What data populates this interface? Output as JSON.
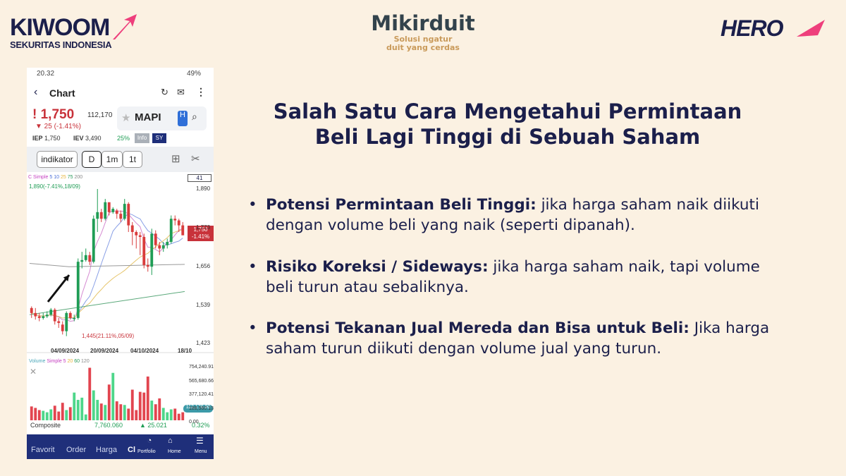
{
  "logos": {
    "kiwoom": "KIWOOM",
    "kiwoom_sub": "SEKURITAS INDONESIA",
    "mikirduit": "Mikirduit",
    "mikirduit_tag1": "Solusi ngatur",
    "mikirduit_tag2": "duit yang cerdas",
    "hero": "HERO"
  },
  "colors": {
    "navy": "#1b1f4b",
    "up": "#1f9d55",
    "down": "#d93c3c",
    "bg": "#fbf1e2"
  },
  "slide": {
    "title_line1": "Salah Satu Cara Mengetahui Permintaan",
    "title_line2": "Beli Lagi Tinggi di Sebuah Saham",
    "bullets": [
      {
        "bold": "Potensi Permintaan Beli Tinggi:",
        "text": " jika harga saham naik diikuti dengan volume beli yang naik (seperti dipanah)."
      },
      {
        "bold": "Risiko Koreksi / Sideways:",
        "text": " jika harga saham naik, tapi volume beli turun atau sebaliknya."
      },
      {
        "bold": "Potensi Tekanan Jual Mereda dan Bisa untuk Beli:",
        "text": " Jika harga saham turun diikuti dengan volume jual yang turun."
      }
    ]
  },
  "phone": {
    "status": {
      "time": "20.32",
      "battery": "49%"
    },
    "header": {
      "title": "Chart"
    },
    "quote": {
      "price": "1,750",
      "change": "▼ 25 (-1.41%)",
      "volume": "112,170",
      "ticker": "MAPI",
      "board": "H",
      "iep_label": "IEP",
      "iep": "1,750",
      "iev_label": "IEV",
      "iev": "3,490",
      "pct": "25%",
      "info": "Info",
      "sy": "SY"
    },
    "toolbar": {
      "indikator": "indikator",
      "d": "D",
      "m1": "1m",
      "t1": "1t"
    },
    "indicator_legend": {
      "c": "C Simple",
      "p5": "5",
      "p10": "10",
      "p25": "25",
      "p75": "75",
      "p200": "200",
      "count": "41"
    },
    "price_axis": [
      "1,890",
      "1,773",
      "1,656",
      "1,539",
      "1,423"
    ],
    "annotations": {
      "high": "1,890(-7.41%,18/09)",
      "low": "1,445(21.11%,05/09)",
      "last_price": "1,750",
      "last_change": "-1.41%"
    },
    "date_axis": [
      "04/09/2024",
      "20/09/2024",
      "04/10/2024",
      "18/10"
    ],
    "volume_legend": {
      "v": "Volume",
      "s": "Simple",
      "p5": "5",
      "p20": "20",
      "p60": "60",
      "p120": "120"
    },
    "volume_axis": [
      "754,240.91",
      "565,680.66",
      "377,120.41",
      "188,560.13",
      "0.00"
    ],
    "volume_last": "112,170.00",
    "composite": {
      "label": "Composite",
      "value": "7,760.060",
      "change": "▲ 25.021",
      "pct": "0.32%"
    },
    "nav": [
      {
        "label": "Favorit"
      },
      {
        "label": "Order"
      },
      {
        "label": "Harga"
      },
      {
        "label": "Cl"
      },
      {
        "label": "Portfolio"
      },
      {
        "label": "Home"
      },
      {
        "label": "Menu"
      }
    ]
  },
  "chart_data": {
    "type": "candlestick",
    "ylim": [
      1423,
      1890
    ],
    "ohlc": [
      [
        1530,
        1535,
        1500,
        1515
      ],
      [
        1515,
        1530,
        1495,
        1505
      ],
      [
        1505,
        1515,
        1490,
        1500
      ],
      [
        1500,
        1515,
        1495,
        1505
      ],
      [
        1505,
        1520,
        1500,
        1510
      ],
      [
        1510,
        1530,
        1505,
        1525
      ],
      [
        1525,
        1530,
        1480,
        1490
      ],
      [
        1490,
        1500,
        1470,
        1485
      ],
      [
        1480,
        1490,
        1450,
        1460
      ],
      [
        1460,
        1520,
        1445,
        1515
      ],
      [
        1515,
        1520,
        1495,
        1500
      ],
      [
        1500,
        1510,
        1490,
        1500
      ],
      [
        1500,
        1680,
        1495,
        1670
      ],
      [
        1670,
        1700,
        1650,
        1675
      ],
      [
        1675,
        1710,
        1670,
        1690
      ],
      [
        1690,
        1700,
        1660,
        1670
      ],
      [
        1670,
        1810,
        1665,
        1800
      ],
      [
        1800,
        1890,
        1760,
        1820
      ],
      [
        1820,
        1830,
        1790,
        1800
      ],
      [
        1800,
        1860,
        1795,
        1850
      ],
      [
        1850,
        1830,
        1810,
        1820
      ],
      [
        1820,
        1835,
        1815,
        1830
      ],
      [
        1825,
        1830,
        1800,
        1815
      ],
      [
        1815,
        1825,
        1790,
        1800
      ],
      [
        1800,
        1860,
        1795,
        1845
      ],
      [
        1845,
        1850,
        1760,
        1780
      ],
      [
        1780,
        1790,
        1720,
        1760
      ],
      [
        1760,
        1765,
        1710,
        1750
      ],
      [
        1750,
        1760,
        1690,
        1745
      ],
      [
        1745,
        1755,
        1650,
        1660
      ],
      [
        1660,
        1680,
        1640,
        1655
      ],
      [
        1655,
        1770,
        1630,
        1755
      ],
      [
        1755,
        1765,
        1710,
        1720
      ],
      [
        1720,
        1730,
        1690,
        1710
      ],
      [
        1710,
        1730,
        1700,
        1720
      ],
      [
        1720,
        1740,
        1710,
        1730
      ],
      [
        1730,
        1810,
        1725,
        1800
      ],
      [
        1800,
        1810,
        1780,
        1795
      ],
      [
        1795,
        1800,
        1760,
        1780
      ],
      [
        1780,
        1790,
        1750,
        1750
      ]
    ],
    "volume": [
      190,
      170,
      140,
      130,
      110,
      150,
      200,
      120,
      240,
      140,
      180,
      380,
      280,
      310,
      80,
      720,
      410,
      280,
      230,
      210,
      490,
      650,
      260,
      220,
      210,
      160,
      420,
      140,
      390,
      380,
      600,
      270,
      220,
      300,
      170,
      110,
      150,
      160,
      90,
      110
    ]
  }
}
